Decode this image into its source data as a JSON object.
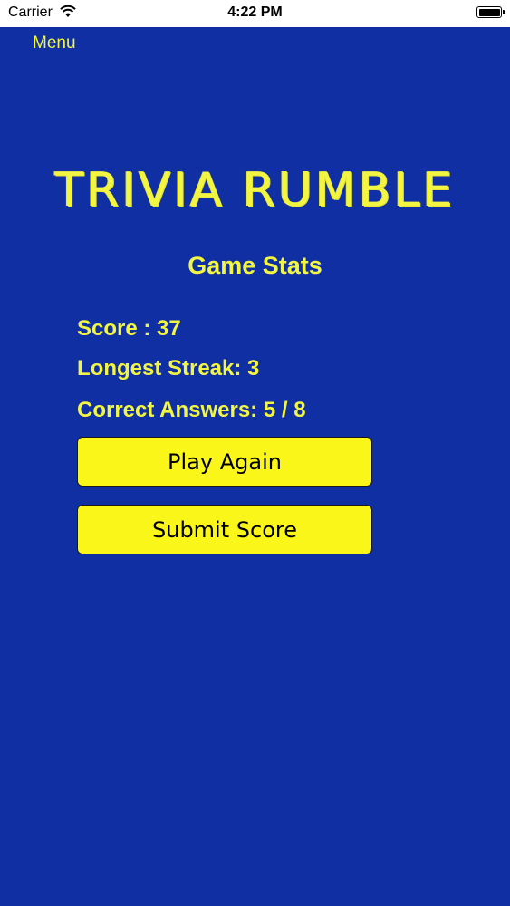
{
  "status_bar": {
    "carrier": "Carrier",
    "time": "4:22 PM"
  },
  "nav": {
    "menu_label": "Menu"
  },
  "title": "TRIVIA RUMBLE",
  "subtitle": "Game Stats",
  "stats": {
    "score": "Score : 37",
    "longest_streak": "Longest Streak: 3",
    "correct_answers": "Correct Answers: 5 / 8"
  },
  "buttons": {
    "play_again": "Play Again",
    "submit_score": "Submit Score"
  },
  "colors": {
    "background": "#0f2fa3",
    "accent_text": "#f2f542",
    "button_fill": "#fbf61a"
  },
  "icons": {
    "wifi": "wifi-icon",
    "battery": "battery-icon"
  }
}
